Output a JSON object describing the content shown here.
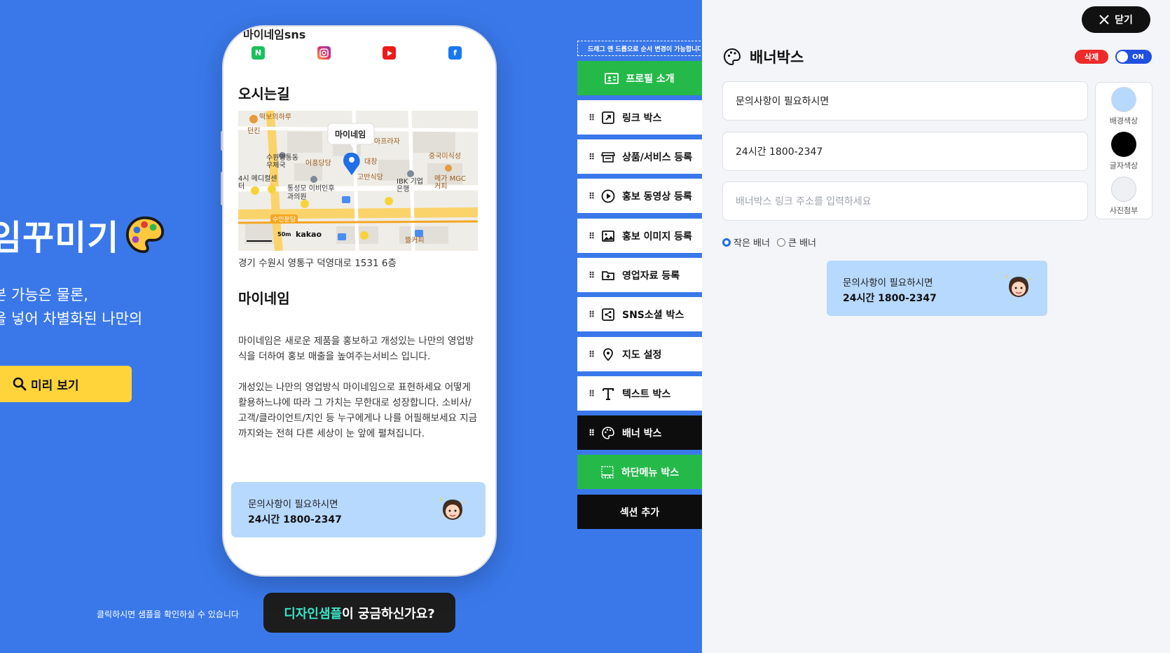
{
  "hero": {
    "title": "임꾸미기",
    "desc_line1": "본 가능은 물론,",
    "desc_line2": "을 넣어 차별화된 나만의",
    "preview_button": "미리 보기"
  },
  "phone": {
    "sns_title": "마이네임sns",
    "map_title": "오시는길",
    "map_pin_label": "마이네임",
    "map_places": [
      "떡보의하루",
      "던킨",
      "아프라자",
      "수원영통동 우체국",
      "어풍당당",
      "대창",
      "중국미식성",
      "고반식당",
      "IBK 기업은행",
      "메가 MGC커피",
      "4시 메디컬센터",
      "통성모 이비인후과의원",
      "수인분당",
      "뜰커피",
      "kakao",
      "50m"
    ],
    "map_address": "경기 수원시 영통구 덕영대로 1531 6층",
    "about_title": "마이네임",
    "about_p1": "마이네임은 새로운 제품을 홍보하고 개성있는 나만의 영업방식을 더하여 홍보 매출을 높여주는서비스 입니다.",
    "about_p2": "개성있는 나만의 영업방식 마이네임으로 표현하세요 어떻게 활용하느냐에 따라 그 가치는 무한대로 성장합니다. 소비사/고객/클라이언트/지인 등 누구에게나 나를 어필해보세요 지금까지와는 전혀 다른 세상이 눈 앞에 펼쳐집니다.",
    "banner_line1": "문의사항이 필요하시면",
    "banner_line2": "24시간 1800-2347"
  },
  "footer": {
    "note": "클릭하시면 샘플을 확인하실 수 있습니다",
    "sample_accent": "디자인샘플",
    "sample_rest": "이 궁금하신가요?"
  },
  "sections": {
    "drag_hint": "드래그 앤 드롭으로 순서 변경이 가능합니다",
    "items": [
      {
        "label": "프로필 소개",
        "icon": "profile-card-icon"
      },
      {
        "label": "링크 박스",
        "icon": "link-arrow-icon"
      },
      {
        "label": "상품/서비스 등록",
        "icon": "store-icon"
      },
      {
        "label": "홍보 동영상 등록",
        "icon": "play-icon"
      },
      {
        "label": "홍보 이미지 등록",
        "icon": "image-icon"
      },
      {
        "label": "영업자료 등록",
        "icon": "folder-plus-icon"
      },
      {
        "label": "SNS소셜 박스",
        "icon": "share-icon"
      },
      {
        "label": "지도 설정",
        "icon": "map-pin-icon"
      },
      {
        "label": "텍스트 박스",
        "icon": "text-icon"
      },
      {
        "label": "배너 박스",
        "icon": "palette-icon"
      },
      {
        "label": "하단메뉴 박스",
        "icon": "grid-menu-icon"
      }
    ],
    "add_section": "섹션 추가"
  },
  "panel": {
    "close_label": "닫기",
    "title": "배너박스",
    "delete_label": "삭제",
    "toggle_label": "ON",
    "field1_value": "문의사항이 필요하시면",
    "field2_value": "24시간 1800-2347",
    "field3_placeholder": "배너박스 링크 주소를 입력하세요",
    "bg_color_label": "배경색상",
    "text_color_label": "글자색상",
    "photo_label": "사진첨부",
    "radio_small": "작은 배너",
    "radio_large": "큰 배너",
    "selected_size": "작은 배너"
  },
  "colors": {
    "background": "#3a78ea",
    "banner_bg": "#b7d9fd",
    "accent_yellow": "#ffd43b",
    "green": "#25b94a",
    "text_color_swatch": "#000000",
    "bg_color_swatch": "#b7d9fd"
  }
}
